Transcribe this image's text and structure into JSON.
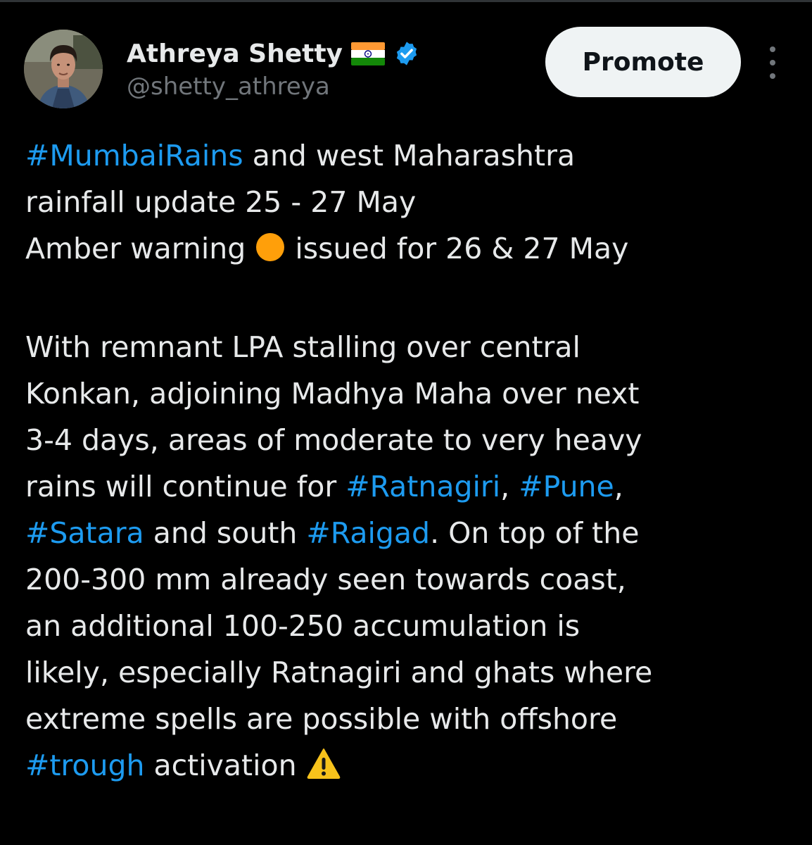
{
  "author": {
    "display_name": "Athreya Shetty",
    "handle": "@shetty_athreya",
    "flag_icon": "india-flag-icon",
    "verified_icon": "verified-badge-icon",
    "avatar_icon": "profile-photo-avatar"
  },
  "actions": {
    "promote_label": "Promote",
    "more_icon": "more-options-icon"
  },
  "tweet": {
    "line1": {
      "tag": "#MumbaiRains",
      "text": " and west Maharashtra"
    },
    "line2": {
      "text": "rainfall update 25 - 27 May"
    },
    "line3": {
      "before": "Amber warning ",
      "emoji": "orange-circle-icon",
      "after": " issued for 26 & 27 May"
    },
    "line4": {
      "text": "With remnant LPA stalling over central"
    },
    "line5": {
      "text": "Konkan, adjoining Madhya Maha over next"
    },
    "line6": {
      "text": "3-4 days, areas of moderate to very heavy"
    },
    "line7": {
      "before": "rains will continue for ",
      "tag1": "#Ratnagiri",
      "sep": ", ",
      "tag2": "#Pune",
      "after": ","
    },
    "line8": {
      "tag1": "#Satara",
      "mid": " and south ",
      "tag2": "#Raigad",
      "after": ". On top of the"
    },
    "line9": {
      "text": "200-300 mm already seen towards coast,"
    },
    "line10": {
      "text": "an additional 100-250 accumulation is"
    },
    "line11": {
      "text": "likely, especially Ratnagiri and ghats where"
    },
    "line12": {
      "text": "extreme spells are possible with offshore"
    },
    "line13": {
      "tag": "#trough",
      "text": " activation ",
      "emoji": "warning-sign-icon"
    }
  },
  "colors": {
    "background": "#000000",
    "text": "#e7e9ea",
    "muted": "#71767b",
    "link": "#1d9bf0",
    "verified": "#1d9bf0",
    "promote_bg": "#eff3f4",
    "amber": "#ff9f0a",
    "warning": "#f7c21b"
  }
}
